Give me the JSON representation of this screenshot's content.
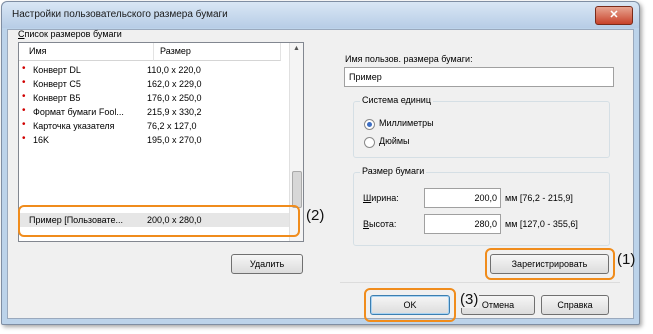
{
  "window": {
    "title": "Настройки пользовательского размера бумаги",
    "close_icon": "close-icon"
  },
  "list": {
    "label": "Список размеров бумаги",
    "col_name": "Имя",
    "col_size": "Размер",
    "rows": [
      {
        "name": "Конверт DL",
        "size": "110,0 x 220,0"
      },
      {
        "name": "Конверт C5",
        "size": "162,0 x 229,0"
      },
      {
        "name": "Конверт B5",
        "size": "176,0 x 250,0"
      },
      {
        "name": "Формат бумаги Fool...",
        "size": "215,9 x 330,2"
      },
      {
        "name": "Карточка указателя",
        "size": "76,2 x 127,0"
      },
      {
        "name": "16K",
        "size": "195,0 x 270,0"
      },
      {
        "name": "Пример [Пользовате...",
        "size": "200,0 x 280,0"
      }
    ],
    "delete_label": "Удалить"
  },
  "custom": {
    "name_label": "Имя пользов. размера бумаги:",
    "name_value": "Пример",
    "units": {
      "title": "Система единиц",
      "mm": "Миллиметры",
      "inch": "Дюймы",
      "selected": "mm"
    },
    "size": {
      "title": "Размер бумаги",
      "width_label": "Ширина:",
      "width_value": "200,0",
      "width_range": "мм [76,2 - 215,9]",
      "height_label": "Высота:",
      "height_value": "280,0",
      "height_range": "мм [127,0 - 355,6]"
    },
    "register_label": "Зарегистрировать"
  },
  "footer": {
    "ok_label": "OK",
    "cancel_label": "Отмена",
    "help_label": "Справка"
  },
  "annotations": {
    "a1": "(1)",
    "a2": "(2)",
    "a3": "(3)",
    "color": "#f08c1c"
  }
}
